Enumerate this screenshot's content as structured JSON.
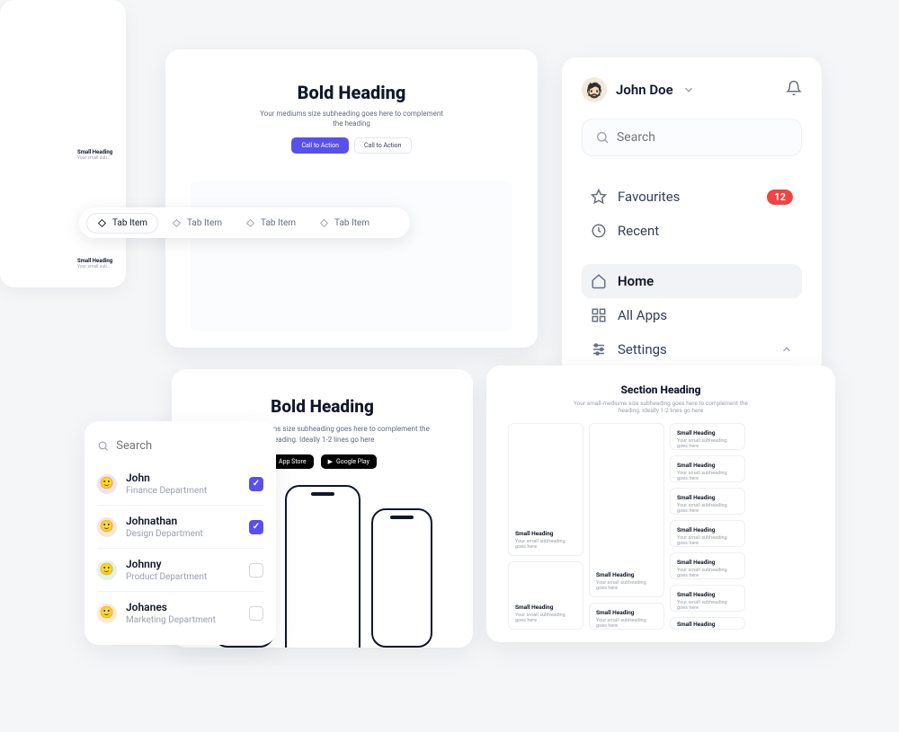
{
  "hero1": {
    "title": "Bold Heading",
    "subtitle": "Your mediums size subheading goes here to complement the heading",
    "primary_cta": "Call to Action",
    "secondary_cta": "Call to Action"
  },
  "partial": {
    "small_heading": "Small Heading",
    "small_sub": "Your small sub…"
  },
  "tabbar": {
    "items": [
      {
        "label": "Tab Item"
      },
      {
        "label": "Tab Item"
      },
      {
        "label": "Tab Item"
      },
      {
        "label": "Tab Item"
      }
    ]
  },
  "sidebar": {
    "user_name": "John Doe",
    "search_placeholder": "Search",
    "fav": {
      "label": "Favourites",
      "badge": "12"
    },
    "recent": {
      "label": "Recent"
    },
    "home": {
      "label": "Home"
    },
    "apps": {
      "label": "All Apps"
    },
    "settings": {
      "label": "Settings"
    }
  },
  "searchlist": {
    "placeholder": "Search",
    "rows": [
      {
        "name": "John",
        "dept": "Finance Department",
        "checked": true,
        "avatar_bg": "#efe2f8"
      },
      {
        "name": "Johnathan",
        "dept": "Design Department",
        "checked": true,
        "avatar_bg": "#f8e6db"
      },
      {
        "name": "Johnny",
        "dept": "Product Department",
        "checked": false,
        "avatar_bg": "#dff4e5"
      },
      {
        "name": "Johanes",
        "dept": "Marketing Department",
        "checked": false,
        "avatar_bg": "#fbeccf"
      }
    ]
  },
  "hero2": {
    "title": "Bold Heading",
    "subtitle": "Your small-mediums size subheading goes here to complement the heading. Ideally 1-2 lines go here",
    "store1": "App Store",
    "store2": "Google Play"
  },
  "bento": {
    "title": "Section Heading",
    "subtitle": "Your small-mediums size subheading goes here to complement the heading. Ideally 1-2 lines go here",
    "heading": "Small Heading",
    "sub": "Your small subheading goes here"
  }
}
